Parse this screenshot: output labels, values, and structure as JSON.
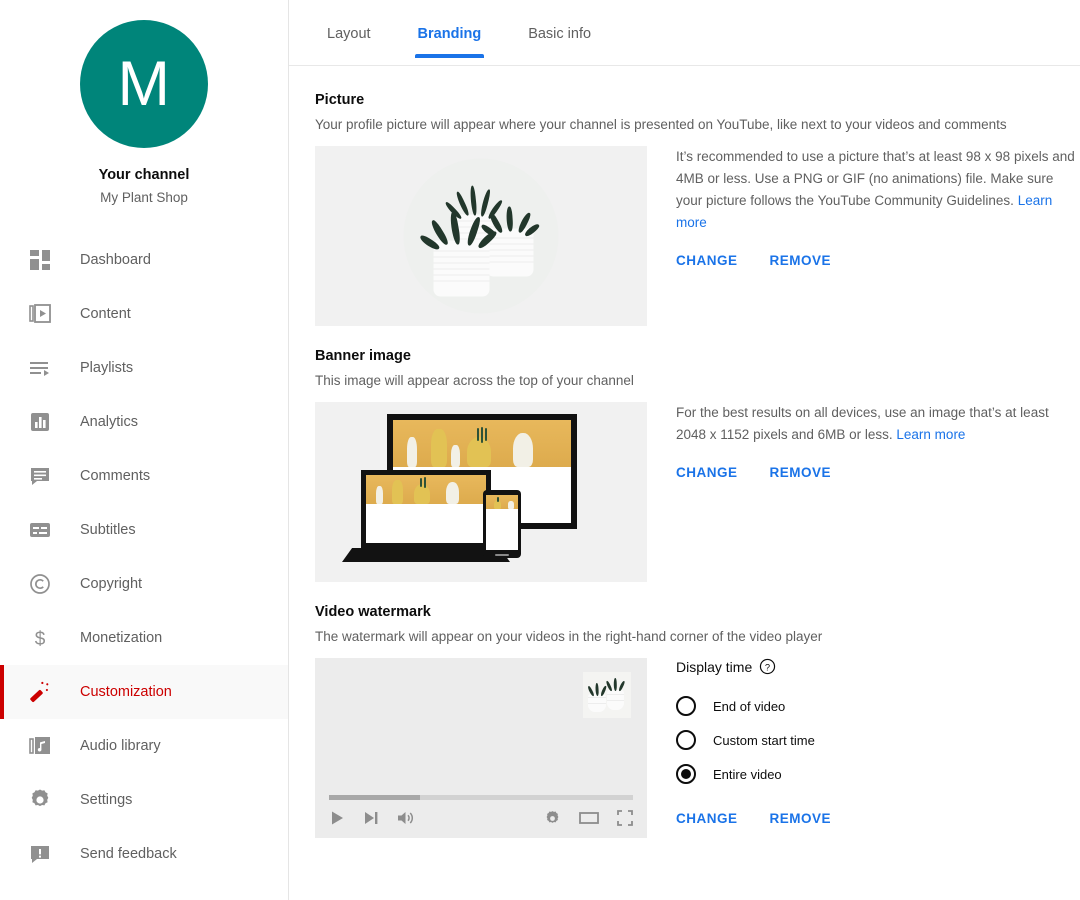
{
  "sidebar": {
    "avatar_letter": "M",
    "channel_label": "Your channel",
    "channel_name": "My Plant Shop",
    "accent_color": "#00857a",
    "active_color": "#cc0000",
    "items": [
      {
        "label": "Dashboard",
        "icon": "dashboard-icon",
        "active": false
      },
      {
        "label": "Content",
        "icon": "content-icon",
        "active": false
      },
      {
        "label": "Playlists",
        "icon": "playlists-icon",
        "active": false
      },
      {
        "label": "Analytics",
        "icon": "analytics-icon",
        "active": false
      },
      {
        "label": "Comments",
        "icon": "comments-icon",
        "active": false
      },
      {
        "label": "Subtitles",
        "icon": "subtitles-icon",
        "active": false
      },
      {
        "label": "Copyright",
        "icon": "copyright-icon",
        "active": false
      },
      {
        "label": "Monetization",
        "icon": "dollar-icon",
        "active": false
      },
      {
        "label": "Customization",
        "icon": "magic-wand-icon",
        "active": true
      },
      {
        "label": "Audio library",
        "icon": "music-library-icon",
        "active": false
      },
      {
        "label": "Settings",
        "icon": "gear-icon",
        "active": false
      },
      {
        "label": "Send feedback",
        "icon": "feedback-icon",
        "active": false
      }
    ]
  },
  "tabs": {
    "accent_color": "#1a73e8",
    "items": [
      {
        "label": "Layout",
        "active": false
      },
      {
        "label": "Branding",
        "active": true
      },
      {
        "label": "Basic info",
        "active": false
      }
    ]
  },
  "sections": {
    "picture": {
      "title": "Picture",
      "description": "Your profile picture will appear where your channel is presented on YouTube, like next to your videos and comments",
      "info": "It’s recommended to use a picture that’s at least 98 x 98 pixels and 4MB or less. Use a PNG or GIF (no animations) file. Make sure your picture follows the YouTube Community Guidelines.",
      "learn_more": "Learn more",
      "change_label": "CHANGE",
      "remove_label": "REMOVE"
    },
    "banner": {
      "title": "Banner image",
      "description": "This image will appear across the top of your channel",
      "info": "For the best results on all devices, use an image that’s at least 2048 x 1152 pixels and 6MB or less.",
      "learn_more": "Learn more",
      "change_label": "CHANGE",
      "remove_label": "REMOVE"
    },
    "watermark": {
      "title": "Video watermark",
      "description": "The watermark will appear on your videos in the right-hand corner of the video player",
      "display_time_label": "Display time",
      "options": [
        {
          "label": "End of video",
          "selected": false
        },
        {
          "label": "Custom start time",
          "selected": false
        },
        {
          "label": "Entire video",
          "selected": true
        }
      ],
      "change_label": "CHANGE",
      "remove_label": "REMOVE"
    }
  }
}
